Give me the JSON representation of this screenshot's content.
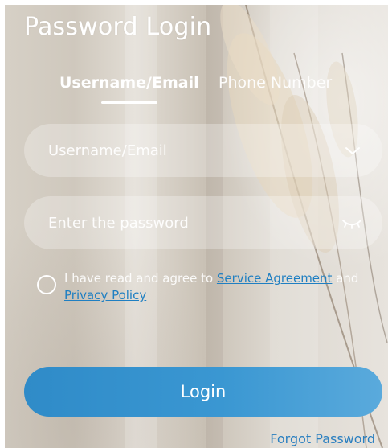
{
  "header": {
    "title": "Password Login"
  },
  "tabs": {
    "active": "Username/Email",
    "inactive": "Phone Number"
  },
  "form": {
    "username_placeholder": "Username/Email",
    "password_placeholder": "Enter the password"
  },
  "agreement": {
    "prefix": "I have read and agree to ",
    "service_link": "Service Agreement",
    "middle": " and",
    "privacy_link": "Privacy Policy",
    "checked": false
  },
  "login_button": {
    "label": "Login"
  },
  "forgot_link": {
    "label": "Forgot Password"
  },
  "icons": {
    "username_dropdown": "chevron-down-icon",
    "password_visibility": "eye-closed-icon",
    "agreement_checkbox": "radio-circle-icon"
  },
  "colors": {
    "accent": "#3a97d2",
    "link": "#1f7fc2"
  }
}
